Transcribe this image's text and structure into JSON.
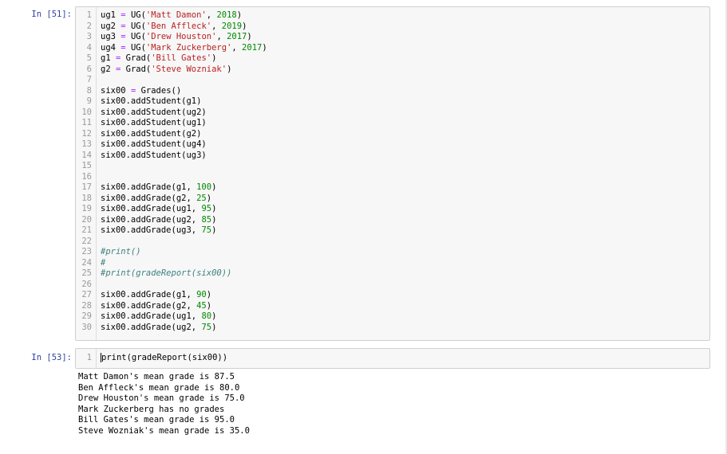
{
  "cells": [
    {
      "prompt": "In [51]:",
      "lines": [
        [
          [
            "ug1 ",
            "t"
          ],
          [
            "=",
            "op"
          ],
          [
            " UG(",
            "t"
          ],
          [
            "'Matt Damon'",
            "s"
          ],
          [
            ", ",
            "t"
          ],
          [
            "2018",
            "n"
          ],
          [
            ")",
            "t"
          ]
        ],
        [
          [
            "ug2 ",
            "t"
          ],
          [
            "=",
            "op"
          ],
          [
            " UG(",
            "t"
          ],
          [
            "'Ben Affleck'",
            "s"
          ],
          [
            ", ",
            "t"
          ],
          [
            "2019",
            "n"
          ],
          [
            ")",
            "t"
          ]
        ],
        [
          [
            "ug3 ",
            "t"
          ],
          [
            "=",
            "op"
          ],
          [
            " UG(",
            "t"
          ],
          [
            "'Drew Houston'",
            "s"
          ],
          [
            ", ",
            "t"
          ],
          [
            "2017",
            "n"
          ],
          [
            ")",
            "t"
          ]
        ],
        [
          [
            "ug4 ",
            "t"
          ],
          [
            "=",
            "op"
          ],
          [
            " UG(",
            "t"
          ],
          [
            "'Mark Zuckerberg'",
            "s"
          ],
          [
            ", ",
            "t"
          ],
          [
            "2017",
            "n"
          ],
          [
            ")",
            "t"
          ]
        ],
        [
          [
            "g1 ",
            "t"
          ],
          [
            "=",
            "op"
          ],
          [
            " Grad(",
            "t"
          ],
          [
            "'Bill Gates'",
            "s"
          ],
          [
            ")",
            "t"
          ]
        ],
        [
          [
            "g2 ",
            "t"
          ],
          [
            "=",
            "op"
          ],
          [
            " Grad(",
            "t"
          ],
          [
            "'Steve Wozniak'",
            "s"
          ],
          [
            ")",
            "t"
          ]
        ],
        [],
        [
          [
            "six00 ",
            "t"
          ],
          [
            "=",
            "op"
          ],
          [
            " Grades()",
            "t"
          ]
        ],
        [
          [
            "six00.addStudent(g1)",
            "t"
          ]
        ],
        [
          [
            "six00.addStudent(ug2)",
            "t"
          ]
        ],
        [
          [
            "six00.addStudent(ug1)",
            "t"
          ]
        ],
        [
          [
            "six00.addStudent(g2)",
            "t"
          ]
        ],
        [
          [
            "six00.addStudent(ug4)",
            "t"
          ]
        ],
        [
          [
            "six00.addStudent(ug3)",
            "t"
          ]
        ],
        [],
        [],
        [
          [
            "six00.addGrade(g1, ",
            "t"
          ],
          [
            "100",
            "n"
          ],
          [
            ")",
            "t"
          ]
        ],
        [
          [
            "six00.addGrade(g2, ",
            "t"
          ],
          [
            "25",
            "n"
          ],
          [
            ")",
            "t"
          ]
        ],
        [
          [
            "six00.addGrade(ug1, ",
            "t"
          ],
          [
            "95",
            "n"
          ],
          [
            ")",
            "t"
          ]
        ],
        [
          [
            "six00.addGrade(ug2, ",
            "t"
          ],
          [
            "85",
            "n"
          ],
          [
            ")",
            "t"
          ]
        ],
        [
          [
            "six00.addGrade(ug3, ",
            "t"
          ],
          [
            "75",
            "n"
          ],
          [
            ")",
            "t"
          ]
        ],
        [],
        [
          [
            "#print()",
            "c"
          ]
        ],
        [
          [
            "#",
            "c"
          ]
        ],
        [
          [
            "#print(gradeReport(six00))",
            "c"
          ]
        ],
        [],
        [
          [
            "six00.addGrade(g1, ",
            "t"
          ],
          [
            "90",
            "n"
          ],
          [
            ")",
            "t"
          ]
        ],
        [
          [
            "six00.addGrade(g2, ",
            "t"
          ],
          [
            "45",
            "n"
          ],
          [
            ")",
            "t"
          ]
        ],
        [
          [
            "six00.addGrade(ug1, ",
            "t"
          ],
          [
            "80",
            "n"
          ],
          [
            ")",
            "t"
          ]
        ],
        [
          [
            "six00.addGrade(ug2, ",
            "t"
          ],
          [
            "75",
            "n"
          ],
          [
            ")",
            "t"
          ]
        ]
      ]
    },
    {
      "prompt": "In [53]:",
      "lines": [
        [
          [
            "print(gradeReport(six00))",
            "t"
          ]
        ]
      ]
    }
  ],
  "output": [
    "Matt Damon's mean grade is 87.5",
    "Ben Affleck's mean grade is 80.0",
    "Drew Houston's mean grade is 75.0",
    "Mark Zuckerberg has no grades",
    "Bill Gates's mean grade is 95.0",
    "Steve Wozniak's mean grade is 35.0"
  ],
  "colors": {
    "prompt": "#303f9f",
    "string": "#ba2121",
    "number": "#008800",
    "operator": "#aa22ff",
    "comment": "#408080"
  }
}
